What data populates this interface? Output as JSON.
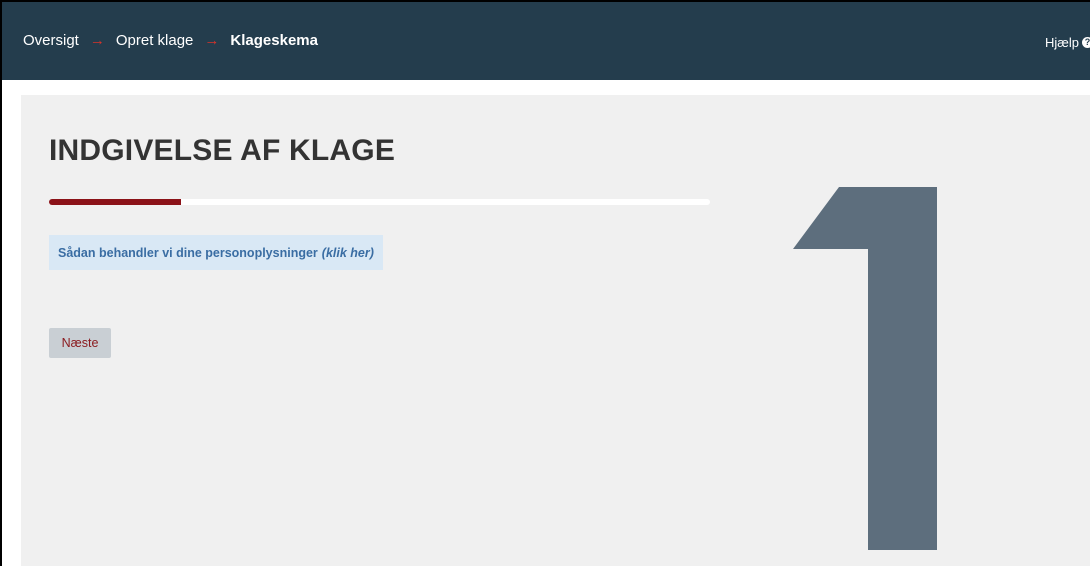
{
  "breadcrumb": {
    "items": [
      "Oversigt",
      "Opret klage",
      "Klageskema"
    ],
    "separator": "→"
  },
  "header": {
    "help_label": "Hjælp",
    "help_icon": "question-circle-icon"
  },
  "main": {
    "title": "INDGIVELSE AF KLAGE",
    "progress_fraction": 0.2,
    "privacy_link": {
      "label": "Sådan behandler vi dine personoplysninger",
      "hint": "(klik her)"
    },
    "next_label": "Næste",
    "step_number": "1"
  },
  "colors": {
    "header_bg": "#243d4d",
    "separator_arrow": "#d8332a",
    "progress_fill": "#8b1218",
    "step_numeral": "#5d6e7d",
    "panel_bg": "#f0f0f0"
  }
}
